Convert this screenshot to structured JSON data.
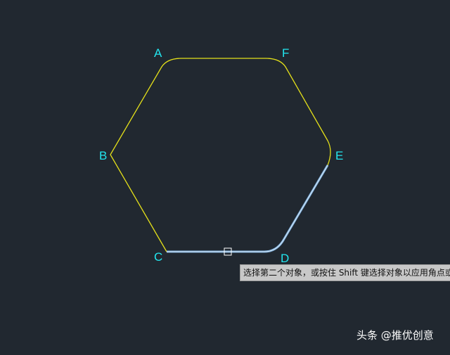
{
  "vertices": {
    "A": "A",
    "F": "F",
    "B": "B",
    "E": "E",
    "C": "C",
    "D": "D"
  },
  "tooltip": {
    "text": "选择第二个对象，或按住 Shift 键选择对象以应用角点或"
  },
  "watermark": {
    "text": "头条 @推优创意"
  },
  "colors": {
    "background": "#212830",
    "polyline": "#e4e01a",
    "selected_highlight": "#7fb2e0",
    "vertex_label": "#22e6ef",
    "pickbox": "#ffffff"
  },
  "icons": {
    "pickbox": "pickbox-cursor-icon"
  }
}
